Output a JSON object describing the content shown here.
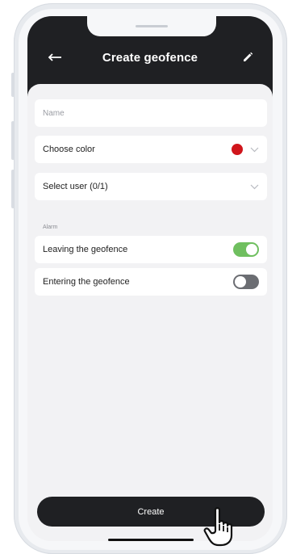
{
  "header": {
    "title": "Create geofence",
    "back_icon": "arrow-left-icon",
    "edit_icon": "pencil-icon"
  },
  "form": {
    "name_placeholder": "Name",
    "name_value": "",
    "choose_color_label": "Choose color",
    "selected_color": "#d0151b",
    "select_user_label": "Select user (0/1)",
    "alarm_section_label": "Alarm",
    "alarms": [
      {
        "label": "Leaving the geofence",
        "enabled": true
      },
      {
        "label": "Entering the geofence",
        "enabled": false
      }
    ]
  },
  "footer": {
    "create_label": "Create",
    "pointer_icon": "hand-pointer-icon"
  },
  "colors": {
    "header_bg": "#1f2023",
    "toggle_on": "#6fbf5f",
    "toggle_off": "#6b6d72",
    "screen_bg": "#f2f2f4"
  }
}
